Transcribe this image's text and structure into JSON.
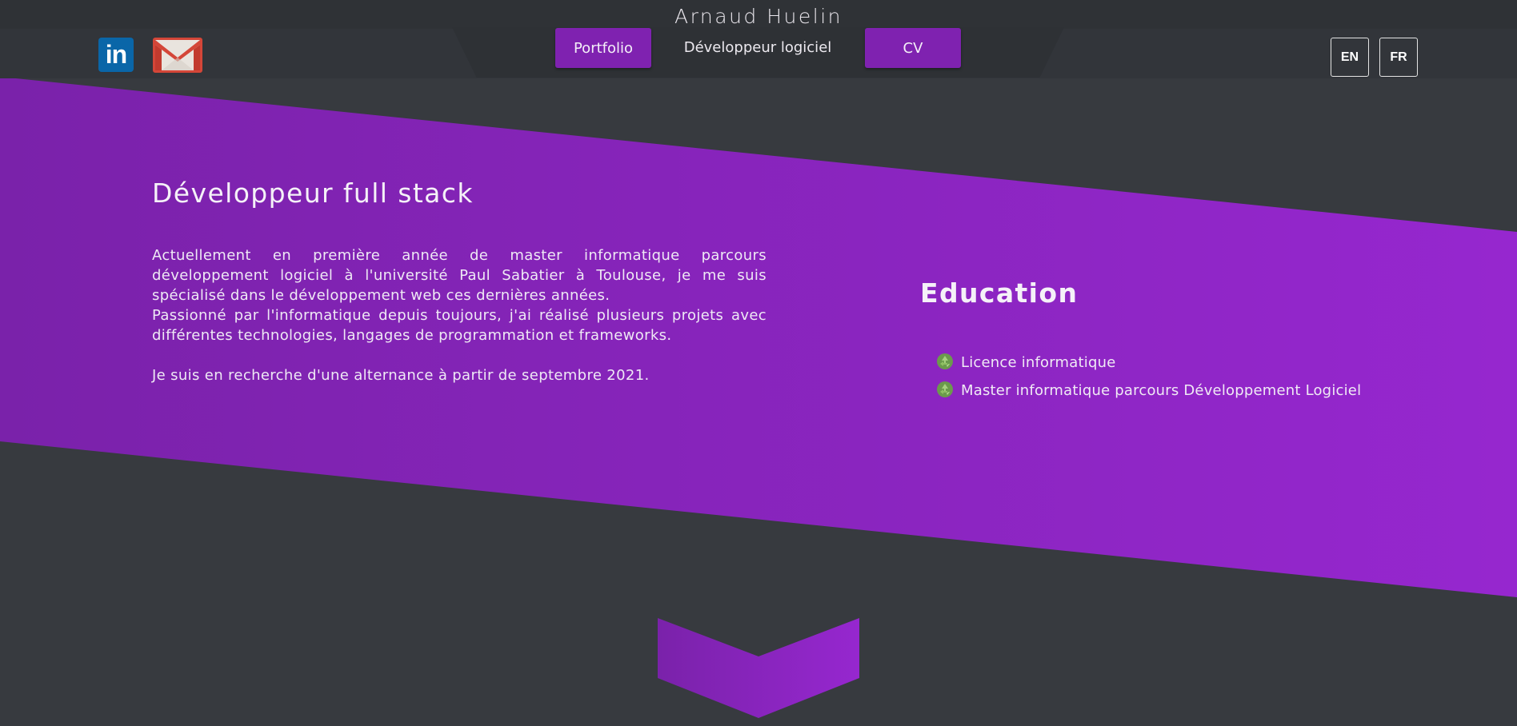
{
  "header": {
    "site_title": "Arnaud Huelin",
    "subtitle": "Développeur logiciel",
    "nav": {
      "portfolio_label": "Portfolio",
      "cv_label": "CV"
    },
    "languages": [
      "EN",
      "FR"
    ],
    "social_icons": [
      "linkedin-icon",
      "gmail-icon"
    ],
    "linkedin_text": "in"
  },
  "hero": {
    "title": "Développeur full stack",
    "paragraph_1": "Actuellement en première année de master informatique parcours développement logiciel à l'université Paul Sabatier à Toulouse, je me suis spécialisé dans le développement web ces dernières années.",
    "paragraph_2": "Passionné par l'informatique depuis toujours, j'ai réalisé plusieurs projets avec différentes technologies, langages de programmation et frameworks.",
    "paragraph_3": "Je suis en recherche d'une alternance à partir de septembre 2021."
  },
  "education": {
    "title": "Education",
    "items": [
      "Licence informatique",
      "Master informatique parcours Développement Logiciel"
    ],
    "bullet_icon": "recycle-bullet-icon"
  },
  "colors": {
    "background": "#373a3f",
    "accent_start": "#7a22aa",
    "accent_end": "#9626cc",
    "header": "#2f3236"
  },
  "scroll_icon": "chevron-down-icon"
}
